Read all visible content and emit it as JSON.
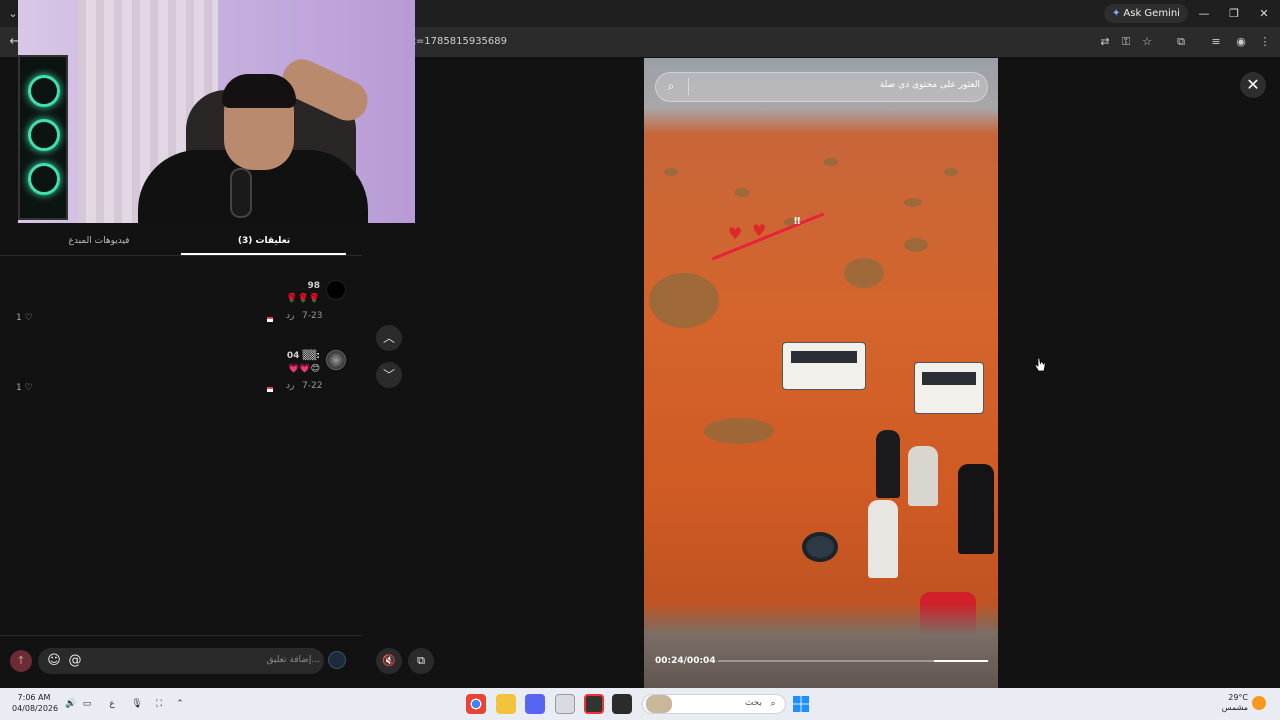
{
  "browser": {
    "url_fragment": "t=1785815935689",
    "gemini_label": "Ask Gemini",
    "window_controls": [
      "—",
      "❐",
      "✕"
    ]
  },
  "comments_panel": {
    "tabs": [
      {
        "label": "فيديوهات المبدع",
        "active": false
      },
      {
        "label": "(3) تعليقات",
        "active": true
      }
    ],
    "comments": [
      {
        "user": "98",
        "text": "🌹🌹🌹",
        "date": "7-23",
        "reply": "رد",
        "likes": "1 ♡"
      },
      {
        "user": "04 ▒▒:",
        "text": "💗💗😊",
        "date": "7-22",
        "reply": "رد",
        "likes": "1 ♡"
      }
    ],
    "input": {
      "placeholder": "إضافة تعليق...",
      "emoji_icon": "☺",
      "mention_icon": "@",
      "send_icon": "↑"
    }
  },
  "player": {
    "search_placeholder": "العثور على محتوى ذي صلة",
    "time": "00:24/00:04",
    "progress": 0.2,
    "nav_up": "︿",
    "nav_down": "﹀",
    "mute_icon": "🔇",
    "pip_icon": "⧉",
    "close_icon": "✕"
  },
  "taskbar": {
    "time": "7:06 AM",
    "date": "04/08/2026",
    "lang": "ع",
    "search_text": "بحث",
    "temperature": "29°C",
    "weather": "مشمس"
  },
  "colors": {
    "background": "#121212",
    "taskbar": "#e9ecf2",
    "accent_red": "#e8223a"
  }
}
